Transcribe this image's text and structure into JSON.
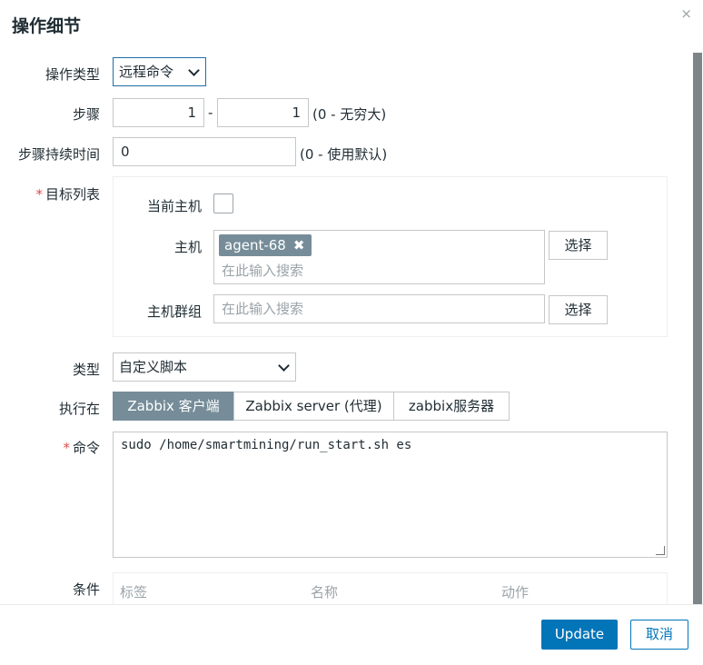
{
  "dialog": {
    "title": "操作细节",
    "close_symbol": "×"
  },
  "operation_type": {
    "label": "操作类型",
    "value": "远程命令"
  },
  "steps": {
    "label": "步骤",
    "from": "1",
    "separator": "-",
    "to": "1",
    "note": "(0 - 无穷大)"
  },
  "step_duration": {
    "label": "步骤持续时间",
    "value": "0",
    "note": "(0 - 使用默认)"
  },
  "target_list": {
    "required_mark": "*",
    "label": "目标列表",
    "current_host": {
      "label": "当前主机",
      "checked": false
    },
    "host": {
      "label": "主机",
      "tags": [
        "agent-68"
      ],
      "tag_remove_symbol": "✖",
      "placeholder": "在此输入搜索",
      "select_label": "选择"
    },
    "host_group": {
      "label": "主机群组",
      "placeholder": "在此输入搜索",
      "select_label": "选择"
    }
  },
  "type": {
    "label": "类型",
    "value": "自定义脚本"
  },
  "execute_on": {
    "label": "执行在",
    "options": [
      "Zabbix 客户端",
      "Zabbix server (代理)",
      "zabbix服务器"
    ],
    "selected_index": 0
  },
  "command": {
    "required_mark": "*",
    "label": "命令",
    "value": "sudo /home/smartmining/run_start.sh es"
  },
  "conditions": {
    "label": "条件",
    "columns": [
      "标签",
      "名称",
      "动作"
    ]
  },
  "footer": {
    "update_label": "Update",
    "cancel_label": "取消"
  },
  "colors": {
    "primary": "#0275b8",
    "tag_bg": "#768d99",
    "required": "#e24a4a"
  }
}
